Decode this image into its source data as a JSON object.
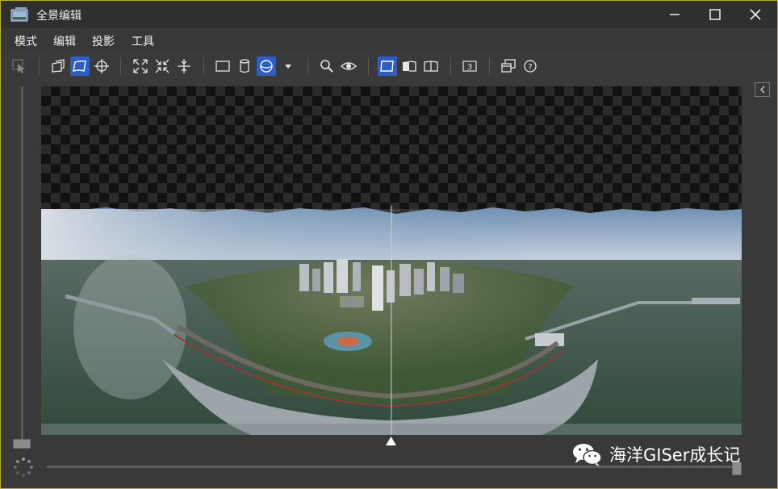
{
  "window": {
    "title": "全景编辑",
    "controls": [
      "minimize-icon",
      "maximize-icon",
      "close-icon"
    ]
  },
  "menu": [
    "模式",
    "编辑",
    "投影",
    "工具"
  ],
  "toolbar": {
    "groups": [
      [
        "select-arrow-icon"
      ],
      [
        "panorama-edit-icon",
        "warp-edit-icon",
        "crosshair-icon"
      ],
      [
        "fit-expand-icon",
        "fit-shrink-icon",
        "center-split-icon"
      ],
      [
        "rectilinear-projection-icon",
        "cylindrical-projection-icon",
        "spherical-projection-icon",
        "dropdown-arrow-icon"
      ],
      [
        "zoom-icon",
        "eye-icon"
      ],
      [
        "layout-normal-icon",
        "layout-mirror-icon",
        "layout-book-icon"
      ],
      [
        "number-3-icon"
      ],
      [
        "windows-icon",
        "help-icon"
      ]
    ],
    "active": [
      "warp-edit-icon",
      "spherical-projection-icon",
      "layout-normal-icon"
    ],
    "number_label": "3",
    "help_label": "?"
  },
  "side_panel": {
    "collapse_icon": "chevron-left-icon"
  },
  "watermark": {
    "text": "海洋GISer成长记",
    "icon": "wechat-icon"
  },
  "colors": {
    "accent": "#2d5ec7",
    "window_border": "#b9b227",
    "background": "#393939"
  }
}
